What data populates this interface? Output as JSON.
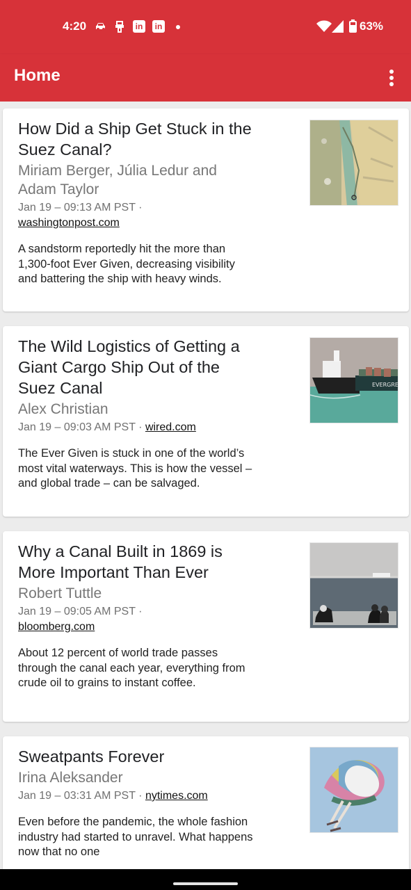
{
  "status": {
    "time": "4:20",
    "battery": "63%",
    "notification_icons": [
      "car-icon",
      "tool-icon",
      "linkedin-icon",
      "linkedin-icon"
    ],
    "linkedin_text": "in",
    "connectivity_icons": [
      "wifi-icon",
      "signal-icon",
      "battery-icon"
    ]
  },
  "appbar": {
    "title": "Home",
    "menu_icon": "more-vert-icon",
    "color": "#d73239"
  },
  "articles": [
    {
      "title": "How Did a Ship Get Stuck in the Suez Canal?",
      "author": "Miriam Berger, Júlia Ledur and Adam Taylor",
      "date": "Jan 19 – 09:13 AM PST",
      "separator": "·",
      "source": "washingtonpost.com",
      "description": "A sandstorm reportedly hit the more than 1,300-foot Ever Given, decreasing visibility and battering the ship with heavy winds.",
      "image": "satellite-image"
    },
    {
      "title": "The Wild Logistics of Getting a Giant Cargo Ship Out of the Suez Canal",
      "author": "Alex Christian",
      "date": "Jan 19 – 09:03 AM PST",
      "separator": "·",
      "source": "wired.com",
      "description": "The Ever Given is stuck in one of the world’s most vital waterways. This is how the vessel – and global trade – can be salvaged.",
      "image": "cargo-ship-image"
    },
    {
      "title": "Why a Canal Built in 1869 is More Important Than Ever",
      "author": "Robert Tuttle",
      "date": "Jan 19 – 09:05 AM PST",
      "separator": "·",
      "source": "bloomberg.com",
      "description": "About 12 percent of world trade passes through the canal each year, everything from crude oil to grains to instant coffee.",
      "image": "canal-shore-image"
    },
    {
      "title": "Sweatpants Forever",
      "author": "Irina Aleksander",
      "date": "Jan 19 – 03:31 AM PST",
      "separator": "·",
      "source": "nytimes.com",
      "description": "Even before the pandemic, the whole fashion industry had started to unravel. What happens now that no one",
      "image": "clothes-pile-image"
    }
  ]
}
